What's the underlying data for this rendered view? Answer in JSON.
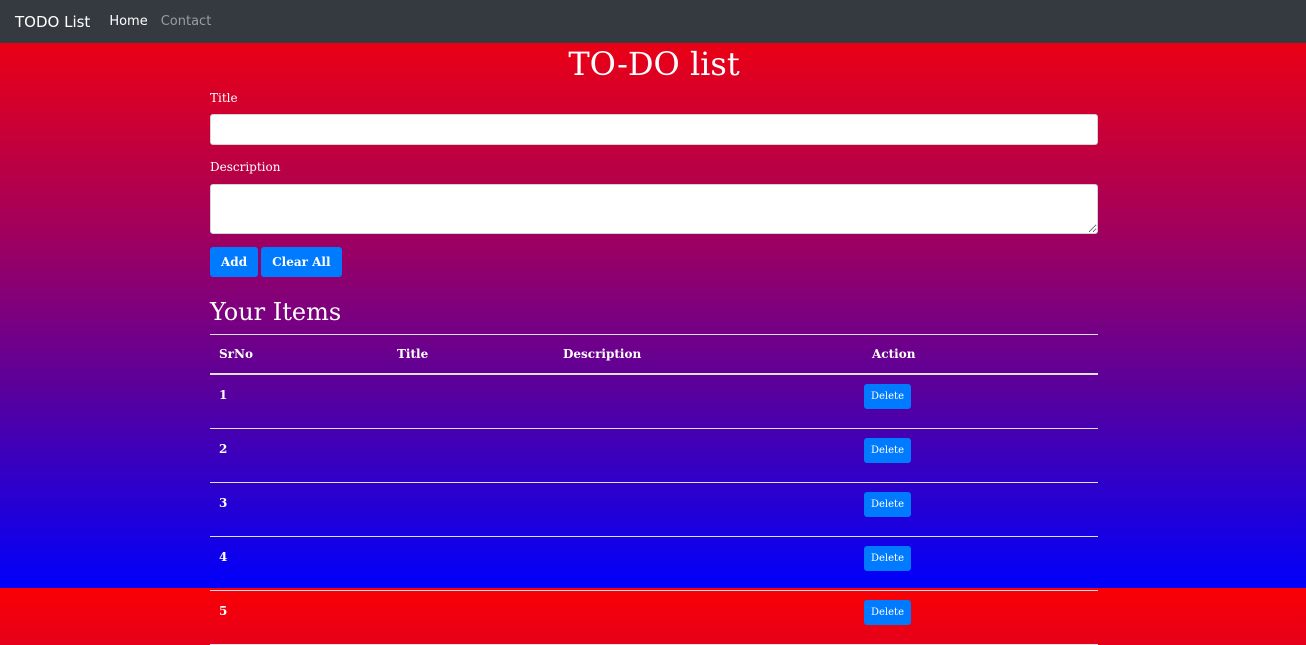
{
  "navbar": {
    "brand": "TODO List",
    "links": [
      {
        "label": "Home"
      },
      {
        "label": "Contact"
      }
    ]
  },
  "main": {
    "title": "TO-DO list",
    "form": {
      "title_label": "Title",
      "title_value": "",
      "description_label": "Description",
      "description_value": "",
      "add_label": "Add",
      "clear_label": "Clear All"
    },
    "items_heading": "Your Items",
    "table": {
      "headers": [
        "SrNo",
        "Title",
        "Description",
        "Action"
      ],
      "rows": [
        {
          "srno": "1",
          "title": "",
          "description": "",
          "action": "Delete"
        },
        {
          "srno": "2",
          "title": "",
          "description": "",
          "action": "Delete"
        },
        {
          "srno": "3",
          "title": "",
          "description": "",
          "action": "Delete"
        },
        {
          "srno": "4",
          "title": "",
          "description": "",
          "action": "Delete"
        },
        {
          "srno": "5",
          "title": "",
          "description": "",
          "action": "Delete"
        }
      ]
    }
  },
  "colors": {
    "navbar_bg": "#343a40",
    "primary_button": "#007bff",
    "gradient_top": "#fb0004",
    "gradient_bottom": "#0000fb"
  }
}
